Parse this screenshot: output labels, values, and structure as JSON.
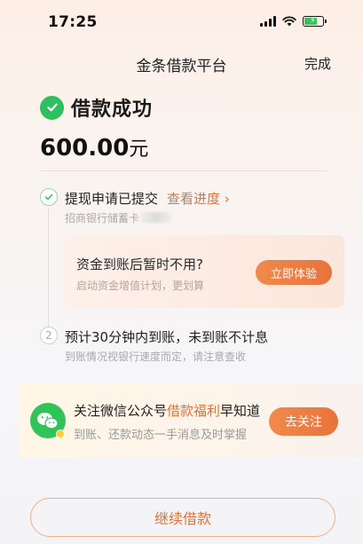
{
  "status_bar": {
    "time": "17:25"
  },
  "nav": {
    "title": "金条借款平台",
    "done_label": "完成"
  },
  "result": {
    "title": "借款成功",
    "amount": "600.00",
    "unit": "元"
  },
  "steps": [
    {
      "index": "",
      "title": "提现申请已提交",
      "link": "查看进度 ›",
      "subtitle": "招商银行储蓄卡"
    },
    {
      "index": "2",
      "title": "预计30分钟内到账，未到账不计息",
      "subtitle": "到账情况视银行速度而定，请注意查收"
    }
  ],
  "promo": {
    "title": "资金到账后暂时不用?",
    "subtitle": "启动资金增值计划，更划算",
    "button": "立即体验"
  },
  "wechat": {
    "title_prefix": "关注微信公众号",
    "title_highlight": "借款福利",
    "title_suffix": "早知道",
    "subtitle": "到账、还款动态一手消息及时掌握",
    "button": "去关注"
  },
  "footer": {
    "continue_label": "继续借款"
  },
  "colors": {
    "accent": "#e8733b",
    "success": "#2fbf5e",
    "wechat": "#31c258"
  }
}
